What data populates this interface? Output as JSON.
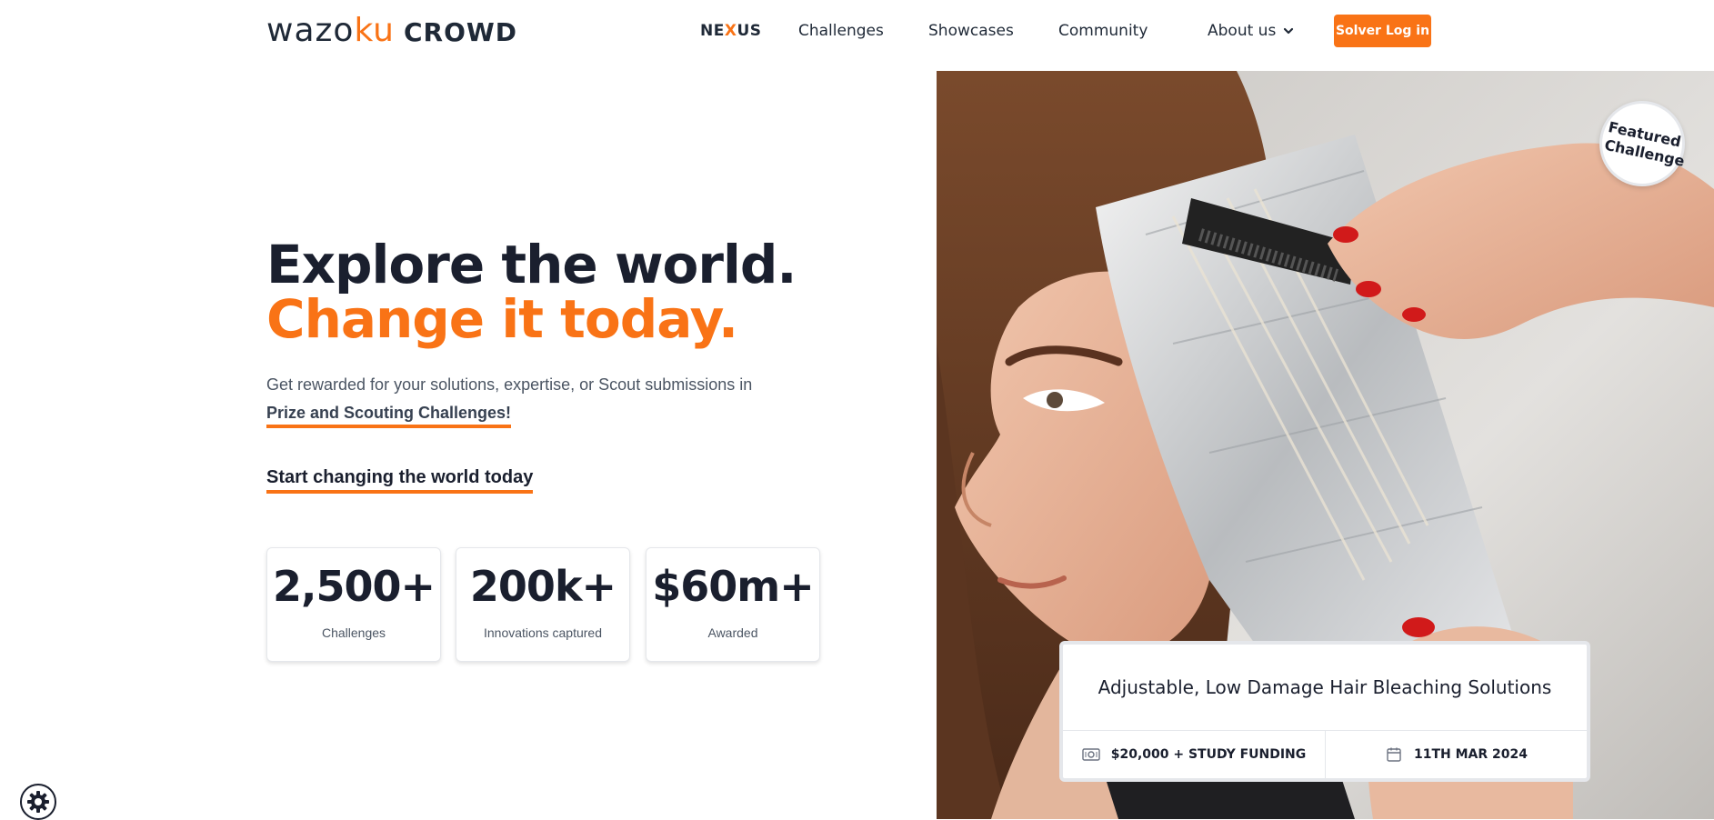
{
  "header": {
    "logo": {
      "part1": "wazo",
      "part2": "ku",
      "part3": "CROWD"
    },
    "nav": [
      {
        "label": "NE",
        "label_accent": "X",
        "label_end": "US"
      },
      {
        "label": "Challenges"
      },
      {
        "label": "Showcases"
      },
      {
        "label": "Community"
      },
      {
        "label": "About us"
      }
    ],
    "login_label": "Solver Log in"
  },
  "hero": {
    "line1": "Explore the world.",
    "line2": "Change it today.",
    "subtitle": "Get rewarded for your solutions, expertise, or Scout submissions in",
    "subtitle_link": "Prize and Scouting Challenges!",
    "cta": "Start changing the world today"
  },
  "stats": [
    {
      "value": "2,500+",
      "label": "Challenges"
    },
    {
      "value": "200k+",
      "label": "Innovations captured"
    },
    {
      "value": "$60m+",
      "label": "Awarded"
    }
  ],
  "featured": {
    "badge_line1": "Featured",
    "badge_line2": "Challenge",
    "title": "Adjustable, Low Damage Hair Bleaching Solutions",
    "prize": "$20,000 + STUDY FUNDING",
    "deadline": "11TH MAR 2024",
    "prize_icon": "money-icon",
    "date_icon": "calendar-icon"
  },
  "colors": {
    "accent": "#f97316",
    "dark": "#1a1f2e"
  }
}
